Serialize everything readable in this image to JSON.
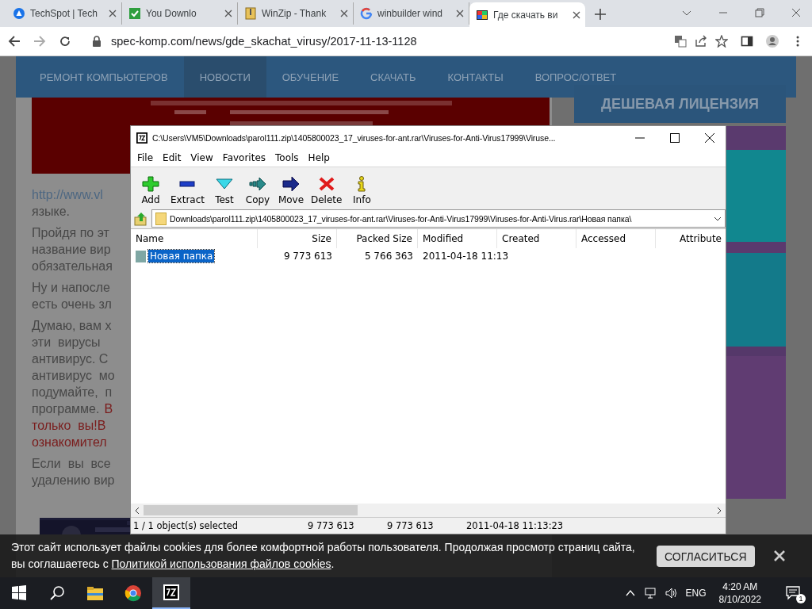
{
  "browser": {
    "tabs": [
      {
        "title": "TechSpot | Tech",
        "selected": false
      },
      {
        "title": "You Downlo",
        "selected": false
      },
      {
        "title": "WinZip - Thank",
        "selected": false
      },
      {
        "title": "winbuilder wind",
        "selected": false
      },
      {
        "title": "Где скачать ви",
        "selected": true
      }
    ],
    "url": "spec-komp.com/news/gde_skachat_virusy/2017-11-13-1128"
  },
  "website": {
    "nav": [
      {
        "label": "РЕМОНТ КОМПЬЮТЕРОВ",
        "selected": false
      },
      {
        "label": "НОВОСТИ",
        "selected": true
      },
      {
        "label": "ОБУЧЕНИЕ",
        "selected": false
      },
      {
        "label": "СКАЧАТЬ",
        "selected": false
      },
      {
        "label": "КОНТАКТЫ",
        "selected": false
      },
      {
        "label": "ВОПРОС/ОТВЕТ",
        "selected": false
      }
    ],
    "sidebar_title": "ДЕШЕВАЯ ЛИЦЕНЗИЯ",
    "paragraphs": [
      [
        [
          {
            "text": "http://www.vl",
            "kind": "link"
          }
        ],
        [
          {
            "text": "языке.",
            "kind": "plain"
          }
        ]
      ],
      [
        [
          {
            "text": "Пройдя по эт",
            "kind": "plain"
          }
        ],
        [
          {
            "text": "название вир",
            "kind": "plain"
          }
        ],
        [
          {
            "text": "обязательная",
            "kind": "plain"
          }
        ]
      ],
      [
        [
          {
            "text": "Ну и напосле",
            "kind": "plain"
          }
        ],
        [
          {
            "text": "есть очень зл",
            "kind": "plain"
          }
        ]
      ],
      [
        [
          {
            "text": "Думаю, вам х",
            "kind": "plain"
          }
        ],
        [
          {
            "text": "эти  вирусы",
            "kind": "plain"
          }
        ],
        [
          {
            "text": "антивирус. С",
            "kind": "plain"
          }
        ],
        [
          {
            "text": "антивирус  мо",
            "kind": "plain"
          }
        ],
        [
          {
            "text": "подумайте,  п",
            "kind": "plain"
          }
        ],
        [
          {
            "text": "программе.",
            "kind": "plain"
          },
          {
            "text": "В",
            "kind": "warning"
          }
        ],
        [
          {
            "text": "только  вы!В",
            "kind": "warning"
          }
        ],
        [
          {
            "text": "ознакомител",
            "kind": "warning"
          }
        ]
      ],
      [
        [
          {
            "text": "Если  вы  все",
            "kind": "plain"
          }
        ],
        [
          {
            "text": "удалению вир",
            "kind": "plain"
          }
        ]
      ]
    ]
  },
  "archive_window": {
    "title": "C:\\Users\\VM5\\Downloads\\parol111.zip\\1405800023_17_viruses-for-ant.rar\\Viruses-for-Anti-Virus17999\\Viruse...",
    "menu": [
      "File",
      "Edit",
      "View",
      "Favorites",
      "Tools",
      "Help"
    ],
    "toolbar": [
      "Add",
      "Extract",
      "Test",
      "Copy",
      "Move",
      "Delete",
      "Info"
    ],
    "path": "Downloads\\parol111.zip\\1405800023_17_viruses-for-ant.rar\\Viruses-for-Anti-Virus17999\\Viruses-for-Anti-Virus.rar\\Новая папка\\",
    "columns": [
      "Name",
      "Size",
      "Packed Size",
      "Modified",
      "Created",
      "Accessed",
      "Attribute"
    ],
    "rows": [
      {
        "cells": [
          "Новая папка",
          "9 773 613",
          "5 766 363",
          "2011-04-18 11:13",
          "",
          "",
          ""
        ],
        "selected": true
      }
    ],
    "status": [
      "1 / 1 object(s) selected",
      "9 773 613",
      "9 773 613",
      "2011-04-18 11:13:23"
    ]
  },
  "cookie_notice": {
    "text": "Этот сайт использует файлы cookies для более комфортной работы пользователя. Продолжая просмотр страниц сайта, вы соглашаетесь с ",
    "link": "Политикой использования файлов cookies",
    "after": ".",
    "button": "СОГЛАСИТЬСЯ"
  },
  "taskbar": {
    "apps": [
      {
        "selected": false
      },
      {
        "selected": false
      },
      {
        "selected": true
      }
    ],
    "language": "ENG",
    "time": "4:20 AM",
    "date": "8/10/2022",
    "notifications": "1"
  }
}
